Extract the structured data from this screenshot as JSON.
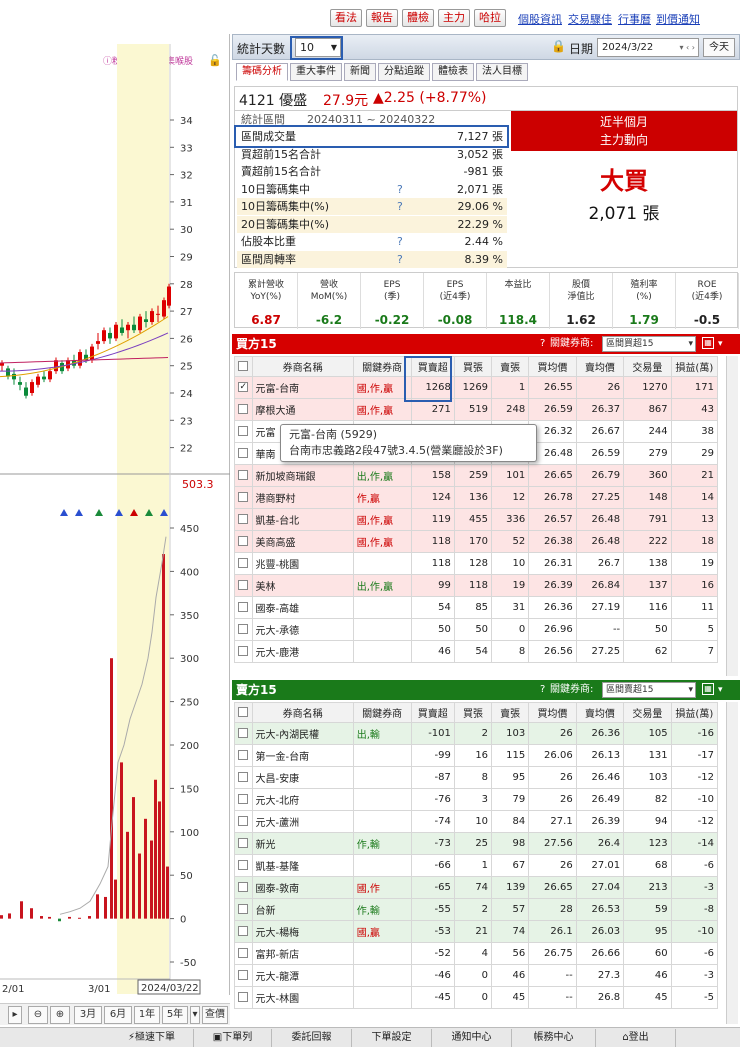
{
  "topbar": {
    "buttons": [
      "看法",
      "報告",
      "體檢",
      "主力",
      "哈拉"
    ],
    "links": [
      "個股資訊",
      "交易驟佳",
      "行事曆",
      "到價通知"
    ]
  },
  "chart": {
    "legend_note": "粉紅色區塊為集喉股",
    "price_ticks": [
      "34",
      "33",
      "32",
      "31",
      "30",
      "29",
      "28",
      "27",
      "26",
      "25",
      "24",
      "23",
      "22"
    ],
    "volume_label": "503.3",
    "vol_ticks": [
      "450",
      "400",
      "350",
      "300",
      "250",
      "200",
      "150",
      "100",
      "50",
      "0",
      "-50"
    ],
    "x_labels": [
      "2/01",
      "3/01",
      "2024/03/22"
    ]
  },
  "chart_controls": {
    "range": [
      "3月",
      "6月",
      "1年",
      "5年"
    ],
    "query": "查價"
  },
  "stats_header": {
    "days_label": "統計天數",
    "days_value": "10",
    "date_label": "日期",
    "date_value": "2024/3/22",
    "today": "今天"
  },
  "tabs": [
    "籌碼分析",
    "重大事件",
    "新聞",
    "分點追蹤",
    "體檢表",
    "法人目標"
  ],
  "stock": {
    "code_name": "4121 優盛",
    "price": "27.9元",
    "change": "▲2.25 (+8.77%)"
  },
  "stats": {
    "period_label": "統計區間",
    "period_value": "20240311 ~ 20240322",
    "rows": [
      {
        "k": "區間成交量",
        "q": "",
        "v": "7,127 張"
      },
      {
        "k": "買超前15名合計",
        "q": "",
        "v": "3,052 張"
      },
      {
        "k": "賣超前15名合計",
        "q": "",
        "v": "-981 張"
      },
      {
        "k": "10日籌碼集中",
        "q": "?",
        "v": "2,071 張"
      },
      {
        "k": "10日籌碼集中(%)",
        "q": "?",
        "v": "29.06 %"
      },
      {
        "k": "20日籌碼集中(%)",
        "q": "",
        "v": "22.29 %"
      },
      {
        "k": "佔股本比重",
        "q": "?",
        "v": "2.44 %"
      },
      {
        "k": "區間周轉率",
        "q": "?",
        "v": "8.39 %"
      }
    ]
  },
  "trend": {
    "title1": "近半個月",
    "title2": "主力動向",
    "verdict": "大買",
    "amount": "2,071 張"
  },
  "metrics": [
    {
      "l1": "累計營收",
      "l2": "YoY(%)",
      "v": "6.87",
      "c": "#c00"
    },
    {
      "l1": "營收",
      "l2": "MoM(%)",
      "v": "-6.2",
      "c": "#1a7a1a"
    },
    {
      "l1": "EPS",
      "l2": "(季)",
      "v": "-0.22",
      "c": "#1a7a1a"
    },
    {
      "l1": "EPS",
      "l2": "(近4季)",
      "v": "-0.08",
      "c": "#1a7a1a"
    },
    {
      "l1": "本益比",
      "l2": "",
      "v": "118.4",
      "c": "#1a7a1a"
    },
    {
      "l1": "股價",
      "l2": "淨值比",
      "v": "1.62",
      "c": "#222"
    },
    {
      "l1": "殖利率",
      "l2": "(%)",
      "v": "1.79",
      "c": "#1a7a1a"
    },
    {
      "l1": "ROE",
      "l2": "(近4季)",
      "v": "-0.5",
      "c": "#222"
    }
  ],
  "buy": {
    "title": "買方15",
    "key_label": "關鍵券商:",
    "select": "區間買超15",
    "headers": [
      "券商名稱",
      "關鍵券商",
      "買賣超",
      "買張",
      "賣張",
      "買均價",
      "賣均價",
      "交易量",
      "損益(萬)"
    ],
    "rows": [
      [
        "元富-台南",
        "國,作,贏",
        "1268",
        "1269",
        "1",
        "26.55",
        "26",
        "1270",
        "171"
      ],
      [
        "摩根大通",
        "國,作,贏",
        "271",
        "519",
        "248",
        "26.59",
        "26.37",
        "867",
        "43"
      ],
      [
        "元富",
        "",
        "",
        "",
        "",
        "26.32",
        "26.67",
        "244",
        "38"
      ],
      [
        "華南",
        "",
        "",
        "",
        "",
        "26.48",
        "26.59",
        "279",
        "29"
      ],
      [
        "新加坡商瑞銀",
        "出,作,贏",
        "158",
        "259",
        "101",
        "26.65",
        "26.79",
        "360",
        "21"
      ],
      [
        "港商野村",
        "作,贏",
        "124",
        "136",
        "12",
        "26.78",
        "27.25",
        "148",
        "14"
      ],
      [
        "凱基-台北",
        "國,作,贏",
        "119",
        "455",
        "336",
        "26.57",
        "26.48",
        "791",
        "13"
      ],
      [
        "美商高盛",
        "國,作,贏",
        "118",
        "170",
        "52",
        "26.38",
        "26.48",
        "222",
        "18"
      ],
      [
        "兆豐-桃園",
        "",
        "118",
        "128",
        "10",
        "26.31",
        "26.7",
        "138",
        "19"
      ],
      [
        "美林",
        "出,作,贏",
        "99",
        "118",
        "19",
        "26.39",
        "26.84",
        "137",
        "16"
      ],
      [
        "國泰-高雄",
        "",
        "54",
        "85",
        "31",
        "26.36",
        "27.19",
        "116",
        "11"
      ],
      [
        "元大-承德",
        "",
        "50",
        "50",
        "0",
        "26.96",
        "--",
        "50",
        "5"
      ],
      [
        "元大-鹿港",
        "",
        "46",
        "54",
        "8",
        "26.56",
        "27.25",
        "62",
        "7"
      ]
    ]
  },
  "sell": {
    "title": "賣方15",
    "key_label": "關鍵券商:",
    "select": "區間賣超15",
    "headers": [
      "券商名稱",
      "關鍵券商",
      "買賣超",
      "買張",
      "賣張",
      "買均價",
      "賣均價",
      "交易量",
      "損益(萬)"
    ],
    "rows": [
      [
        "元大-內湖民權",
        "出,輸",
        "-101",
        "2",
        "103",
        "26",
        "26.36",
        "105",
        "-16"
      ],
      [
        "第一金-台南",
        "",
        "-99",
        "16",
        "115",
        "26.06",
        "26.13",
        "131",
        "-17"
      ],
      [
        "大昌-安康",
        "",
        "-87",
        "8",
        "95",
        "26",
        "26.46",
        "103",
        "-12"
      ],
      [
        "元大-北府",
        "",
        "-76",
        "3",
        "79",
        "26",
        "26.49",
        "82",
        "-10"
      ],
      [
        "元大-蘆洲",
        "",
        "-74",
        "10",
        "84",
        "27.1",
        "26.39",
        "94",
        "-12"
      ],
      [
        "新光",
        "作,輸",
        "-73",
        "25",
        "98",
        "27.56",
        "26.4",
        "123",
        "-14"
      ],
      [
        "凱基-基隆",
        "",
        "-66",
        "1",
        "67",
        "26",
        "27.01",
        "68",
        "-6"
      ],
      [
        "國泰-敦南",
        "國,作",
        "-65",
        "74",
        "139",
        "26.65",
        "27.04",
        "213",
        "-3"
      ],
      [
        "台新",
        "作,輸",
        "-55",
        "2",
        "57",
        "28",
        "26.53",
        "59",
        "-8"
      ],
      [
        "元大-楊梅",
        "國,贏",
        "-53",
        "21",
        "74",
        "26.1",
        "26.03",
        "95",
        "-10"
      ],
      [
        "富邦-新店",
        "",
        "-52",
        "4",
        "56",
        "26.75",
        "26.66",
        "60",
        "-6"
      ],
      [
        "元大-龍潭",
        "",
        "-46",
        "0",
        "46",
        "--",
        "27.3",
        "46",
        "-3"
      ],
      [
        "元大-林園",
        "",
        "-45",
        "0",
        "45",
        "--",
        "26.8",
        "45",
        "-5"
      ]
    ]
  },
  "tooltip": {
    "line1": "元富-台南 (5929)",
    "line2": "台南市忠義路2段47號3.4.5(營業廳設於3F)"
  },
  "bottom": [
    "極速下單",
    "下單列",
    "委託回報",
    "下單設定",
    "通知中心",
    "帳務中心",
    "登出"
  ]
}
